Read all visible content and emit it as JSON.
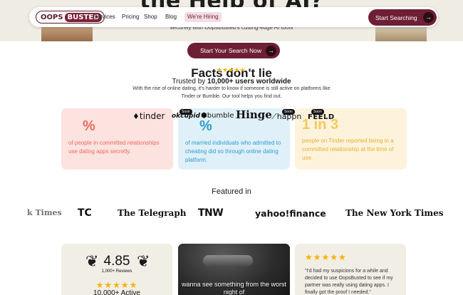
{
  "hero": {
    "title": "the Help of AI?",
    "subtitle": "securely with OopsBusted's cutting-edge AI tools"
  },
  "nav": {
    "logo_left": "OOPS",
    "logo_right": "BUSTED",
    "links": [
      "Services",
      "Pricing",
      "Shop",
      "Blog"
    ],
    "badge": "We're Hiring",
    "cta": "Start Searching"
  },
  "cta_mid": "Start Your Search Now",
  "facts": {
    "title": "Facts don't lie",
    "stars": "★★★★★",
    "trusted_prefix": "Trusted by ",
    "trusted_bold": "10,000+ users worldwide",
    "description": "With the rise of online dating, it's harder to know if someone is still active on platforms like Tinder or Bumble. Our tool helps you find out."
  },
  "cards": [
    {
      "stat": "%",
      "text": "of people in committed relationships use dating apps secretly."
    },
    {
      "stat": "%",
      "text": "of married individuals who admitted to cheating did so through online dating platform."
    },
    {
      "stat": "1 in 3",
      "text": "people on Tinder reported being in a committed relationship at the time of use."
    }
  ],
  "apps": {
    "tinder": "tinder",
    "okcupid": "okcupid",
    "bumble": "bumble",
    "hinge": "Hinge",
    "happn": "happn",
    "feeld": "FEELD",
    "soon_label": "Soon"
  },
  "featured": {
    "title": "Featured in",
    "press": [
      "k Times",
      "TC",
      "The Telegraph",
      "TNW",
      "yahoo!finance",
      "The New York Times"
    ]
  },
  "rating": {
    "score": "4.85",
    "count": "1,000+ Reviews",
    "stars": "★★★★★",
    "active": "10,000+ Active"
  },
  "video": {
    "caption": "wanna see something from the worst night of"
  },
  "review": {
    "stars": "★★★★★",
    "text": "\"I'd had my suspicions for a while and decided to use OopsBusted to see if my partner was really using dating apps. I finally got the proof I needed.\""
  },
  "colors": {
    "brand": "#6e1f36",
    "hero_bg": "#efece3",
    "card_pink": "#fde3df",
    "card_blue": "#e0f0f8",
    "card_yellow": "#fdf3dd",
    "star": "#f5b400"
  }
}
